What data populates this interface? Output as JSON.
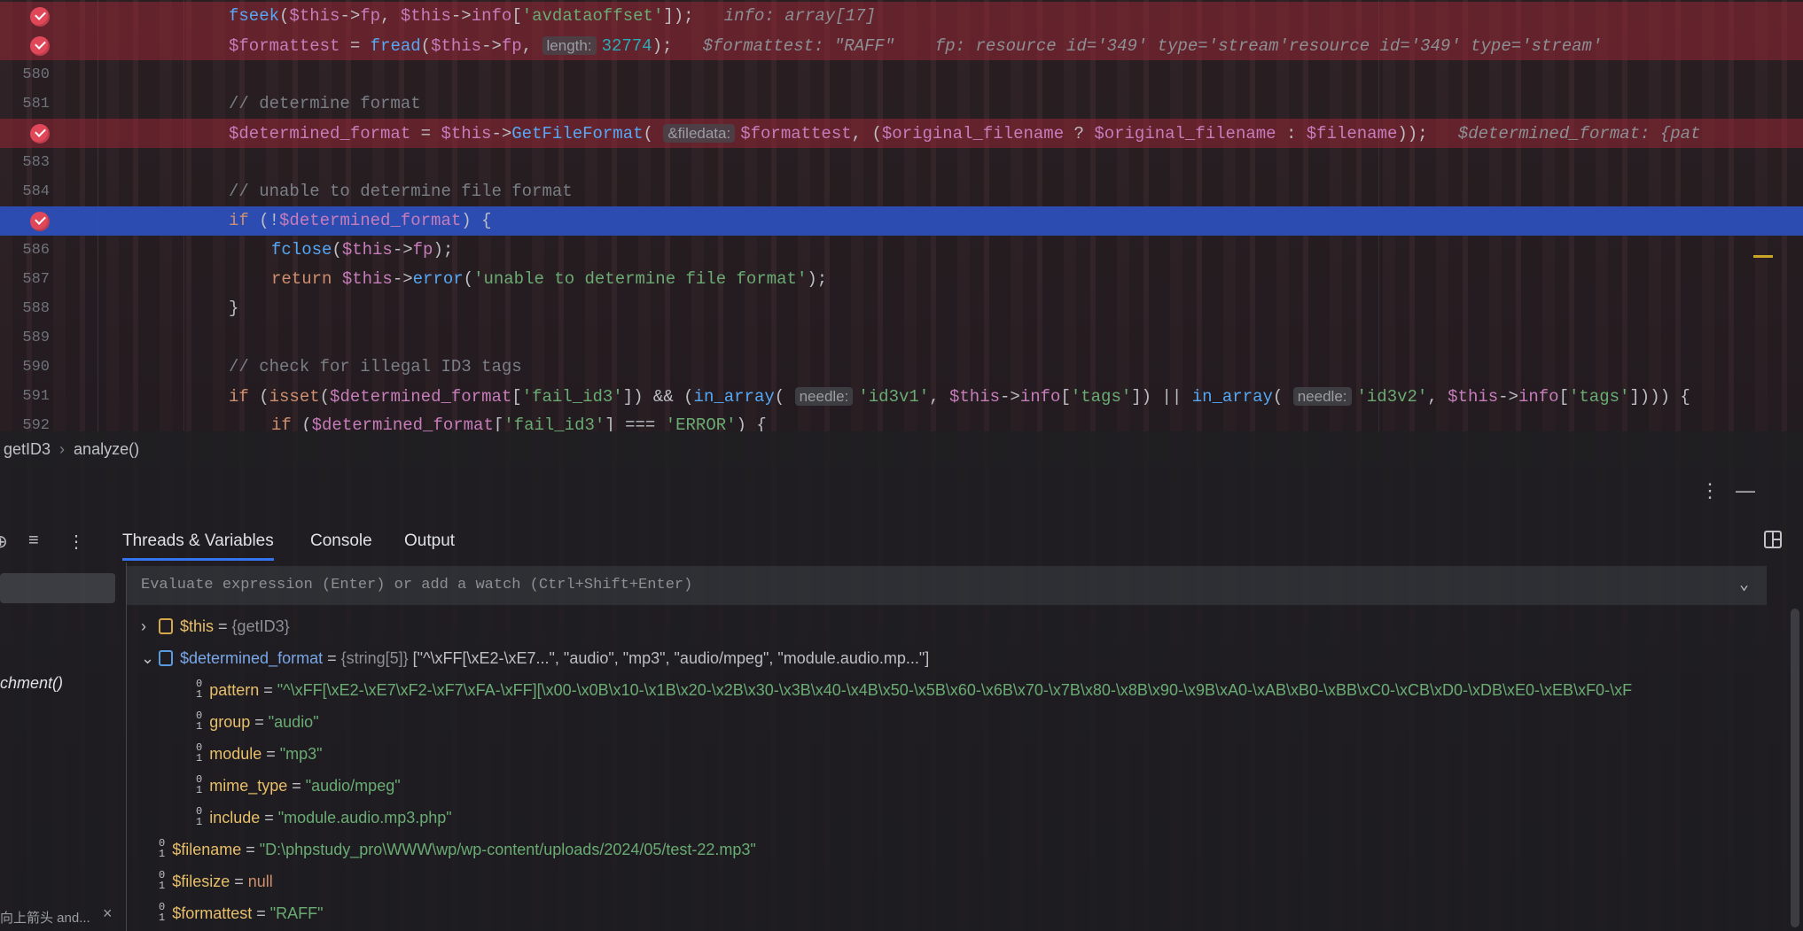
{
  "editor": {
    "lines": [
      {
        "num": "",
        "bp": true,
        "tokens": [
          [
            "f",
            "fseek"
          ],
          [
            "p",
            "("
          ],
          [
            "v",
            "$this"
          ],
          [
            "p",
            "->"
          ],
          [
            "v",
            "fp"
          ],
          [
            "p",
            ", "
          ],
          [
            "v",
            "$this"
          ],
          [
            "p",
            "->"
          ],
          [
            "v",
            "info"
          ],
          [
            "p",
            "["
          ],
          [
            "s",
            "'avdataoffset'"
          ],
          [
            "p",
            "]);  "
          ]
        ],
        "inline": "info: array[17]"
      },
      {
        "num": "",
        "bp": true,
        "tokens": [
          [
            "v",
            "$formattest"
          ],
          [
            "p",
            " = "
          ],
          [
            "f",
            "fread"
          ],
          [
            "p",
            "("
          ],
          [
            "v",
            "$this"
          ],
          [
            "p",
            "->"
          ],
          [
            "v",
            "fp"
          ],
          [
            "p",
            ", "
          ],
          [
            "h",
            "length:"
          ],
          [
            "n",
            "32774"
          ],
          [
            "p",
            ");  "
          ]
        ],
        "inline": "$formattest: \"RAFF\"    fp: resource id='349' type='stream'resource id='349' type='stream'"
      },
      {
        "num": "580",
        "tokens": []
      },
      {
        "num": "581",
        "tokens": [
          [
            "c",
            "// determine format"
          ]
        ]
      },
      {
        "num": "",
        "bp": true,
        "tokens": [
          [
            "v",
            "$determined_format"
          ],
          [
            "p",
            " = "
          ],
          [
            "v",
            "$this"
          ],
          [
            "p",
            "->"
          ],
          [
            "f",
            "GetFileFormat"
          ],
          [
            "p",
            "( "
          ],
          [
            "h",
            "&filedata:"
          ],
          [
            "v",
            "$formattest"
          ],
          [
            "p",
            ", ("
          ],
          [
            "v",
            "$original_filename"
          ],
          [
            "p",
            " ? "
          ],
          [
            "v",
            "$original_filename"
          ],
          [
            "p",
            " : "
          ],
          [
            "v",
            "$filename"
          ],
          [
            "p",
            "));  "
          ]
        ],
        "inline": "$determined_format: {pat"
      },
      {
        "num": "583",
        "tokens": []
      },
      {
        "num": "584",
        "tokens": [
          [
            "c",
            "// unable to determine file format"
          ]
        ]
      },
      {
        "num": "",
        "bp": true,
        "cur": true,
        "tokens": [
          [
            "k",
            "if"
          ],
          [
            "p",
            " (!"
          ],
          [
            "v",
            "$determined_format"
          ],
          [
            "p",
            ") {"
          ]
        ]
      },
      {
        "num": "586",
        "indent": 1,
        "tokens": [
          [
            "f",
            "fclose"
          ],
          [
            "p",
            "("
          ],
          [
            "v",
            "$this"
          ],
          [
            "p",
            "->"
          ],
          [
            "v",
            "fp"
          ],
          [
            "p",
            ");"
          ]
        ]
      },
      {
        "num": "587",
        "indent": 1,
        "tokens": [
          [
            "k",
            "return "
          ],
          [
            "v",
            "$this"
          ],
          [
            "p",
            "->"
          ],
          [
            "f",
            "error"
          ],
          [
            "p",
            "("
          ],
          [
            "s",
            "'unable to determine file format'"
          ],
          [
            "p",
            ");"
          ]
        ]
      },
      {
        "num": "588",
        "tokens": [
          [
            "p",
            "}"
          ]
        ]
      },
      {
        "num": "589",
        "tokens": []
      },
      {
        "num": "590",
        "tokens": [
          [
            "c",
            "// check for illegal ID3 tags"
          ]
        ]
      },
      {
        "num": "591",
        "tokens": [
          [
            "k",
            "if"
          ],
          [
            "p",
            " ("
          ],
          [
            "k",
            "isset"
          ],
          [
            "p",
            "("
          ],
          [
            "v",
            "$determined_format"
          ],
          [
            "p",
            "["
          ],
          [
            "s",
            "'fail_id3'"
          ],
          [
            "p",
            "]) && ("
          ],
          [
            "f",
            "in_array"
          ],
          [
            "p",
            "( "
          ],
          [
            "h",
            "needle:"
          ],
          [
            "s",
            "'id3v1'"
          ],
          [
            "p",
            ", "
          ],
          [
            "v",
            "$this"
          ],
          [
            "p",
            "->"
          ],
          [
            "v",
            "info"
          ],
          [
            "p",
            "["
          ],
          [
            "s",
            "'tags'"
          ],
          [
            "p",
            "]) || "
          ],
          [
            "f",
            "in_array"
          ],
          [
            "p",
            "( "
          ],
          [
            "h",
            "needle:"
          ],
          [
            "s",
            "'id3v2'"
          ],
          [
            "p",
            ", "
          ],
          [
            "v",
            "$this"
          ],
          [
            "p",
            "->"
          ],
          [
            "v",
            "info"
          ],
          [
            "p",
            "["
          ],
          [
            "s",
            "'tags'"
          ],
          [
            "p",
            "]))) {"
          ]
        ]
      },
      {
        "num": "592",
        "indent": 1,
        "tokens": [
          [
            "k",
            "if"
          ],
          [
            "p",
            " ("
          ],
          [
            "v",
            "$determined_format"
          ],
          [
            "p",
            "["
          ],
          [
            "s",
            "'fail_id3'"
          ],
          [
            "p",
            "] === "
          ],
          [
            "s",
            "'ERROR'"
          ],
          [
            "p",
            ") {"
          ]
        ]
      }
    ]
  },
  "breadcrumb": {
    "class": "getID3",
    "method": "analyze()"
  },
  "debug_panel": {
    "tabs": [
      "Threads & Variables",
      "Console",
      "Output"
    ],
    "frame_label": "chment()",
    "hidden_tip": "向上箭头 and...",
    "eval_placeholder": "Evaluate expression (Enter) or add a watch (Ctrl+Shift+Enter)",
    "variables": [
      {
        "level": 0,
        "expand": "›",
        "icon": "object",
        "name": "$this",
        "eq": " = ",
        "type": "{getID3}",
        "value": ""
      },
      {
        "level": 0,
        "expand": "⌄",
        "icon": "array",
        "name": "$determined_format",
        "eq": " = ",
        "type": "{string[5]}",
        "value": "[\"^\\xFF[\\xE2-\\xE7...\", \"audio\", \"mp3\", \"audio/mpeg\", \"module.audio.mp...\"]"
      },
      {
        "level": 1,
        "icon": "num",
        "name": "pattern",
        "eq": " = ",
        "type": "",
        "str": "\"^\\xFF[\\xE2-\\xE7\\xF2-\\xF7\\xFA-\\xFF][\\x00-\\x0B\\x10-\\x1B\\x20-\\x2B\\x30-\\x3B\\x40-\\x4B\\x50-\\x5B\\x60-\\x6B\\x70-\\x7B\\x80-\\x8B\\x90-\\x9B\\xA0-\\xAB\\xB0-\\xBB\\xC0-\\xCB\\xD0-\\xDB\\xE0-\\xEB\\xF0-\\xF"
      },
      {
        "level": 1,
        "icon": "num",
        "name": "group",
        "eq": " = ",
        "str": "\"audio\""
      },
      {
        "level": 1,
        "icon": "num",
        "name": "module",
        "eq": " = ",
        "str": "\"mp3\""
      },
      {
        "level": 1,
        "icon": "num",
        "name": "mime_type",
        "eq": " = ",
        "str": "\"audio/mpeg\""
      },
      {
        "level": 1,
        "icon": "num",
        "name": "include",
        "eq": " = ",
        "str": "\"module.audio.mp3.php\""
      },
      {
        "level": 0,
        "icon": "num",
        "name": "$filename",
        "eq": " = ",
        "str": "\"D:\\phpstudy_pro\\WWW\\wp/wp-content/uploads/2024/05/test-22.mp3\""
      },
      {
        "level": 0,
        "icon": "num",
        "name": "$filesize",
        "eq": " = ",
        "nullv": "null"
      },
      {
        "level": 0,
        "icon": "num",
        "name": "$formattest",
        "eq": " = ",
        "str": "\"RAFF\""
      }
    ]
  }
}
